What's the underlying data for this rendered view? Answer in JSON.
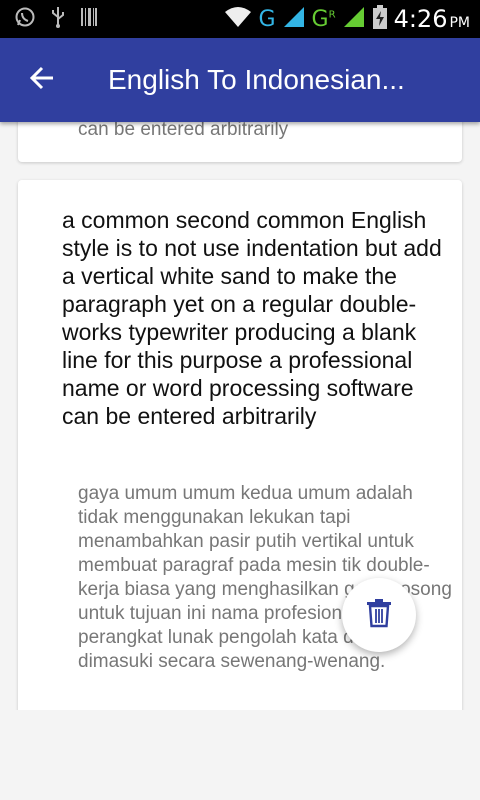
{
  "status_bar": {
    "network_1": "G",
    "network_2": "G",
    "network_2_sup": "R",
    "time": "4:26",
    "ampm": "PM"
  },
  "app_bar": {
    "title": "English To Indonesian..."
  },
  "cards": [
    {
      "translation": "can be entered arbitrarily"
    },
    {
      "source": "a common second common English style is to not use indentation but add a vertical white sand to make the paragraph yet on a regular double-works typewriter producing a blank line for this purpose a professional name or word processing software can be entered arbitrarily",
      "translation": "gaya umum umum kedua umum adalah tidak menggunakan lekukan tapi menambahkan pasir putih vertikal untuk membuat paragraf pada mesin tik double-kerja biasa yang menghasilkan garis kosong untuk tujuan ini nama profesional atau perangkat lunak pengolah kata dapat dimasuki secara sewenang-wenang."
    }
  ],
  "colors": {
    "app_bar": "#303f9f",
    "fab_icon": "#303f9f"
  }
}
